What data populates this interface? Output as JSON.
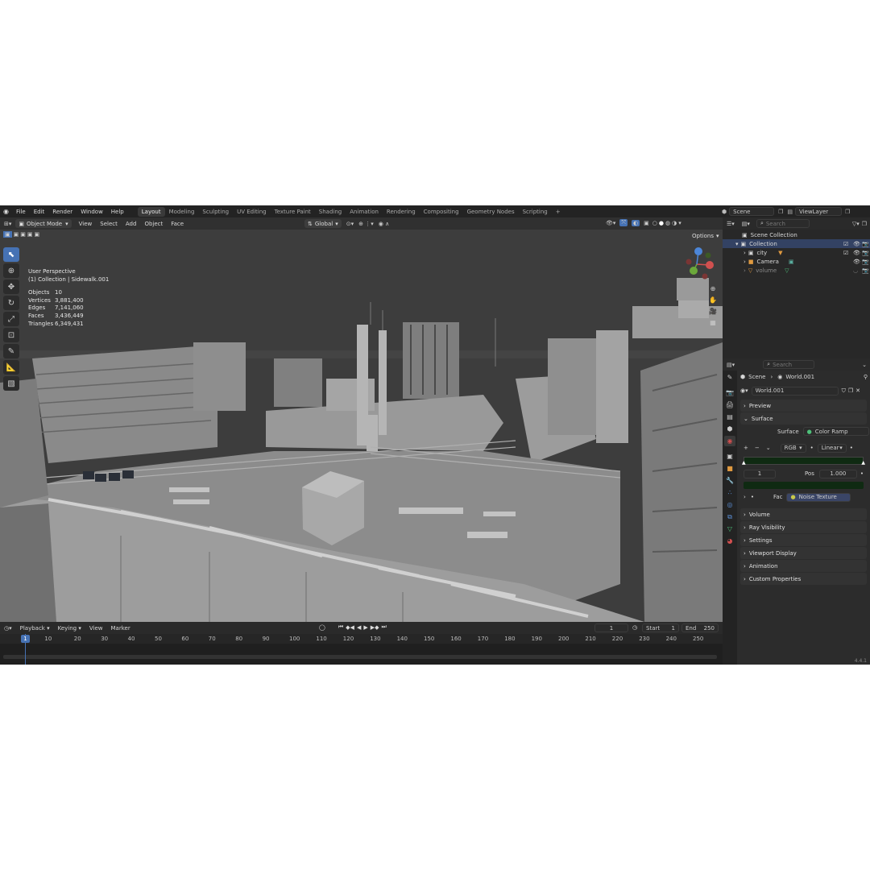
{
  "menubar": {
    "items": [
      "File",
      "Edit",
      "Render",
      "Window",
      "Help"
    ],
    "workspaces": [
      "Layout",
      "Modeling",
      "Sculpting",
      "UV Editing",
      "Texture Paint",
      "Shading",
      "Animation",
      "Rendering",
      "Compositing",
      "Geometry Nodes",
      "Scripting"
    ],
    "active_workspace": "Layout",
    "add_tab": "+",
    "scene": "Scene",
    "view_layer": "ViewLayer"
  },
  "viewport_header": {
    "mode": "Object Mode",
    "menus": [
      "View",
      "Select",
      "Add",
      "Object",
      "Face"
    ],
    "transform_orientation": "Global",
    "options": "Options"
  },
  "viewport": {
    "view_name": "User Perspective",
    "collection_line": "(1) Collection | Sidewalk.001",
    "stats": [
      {
        "k": "Objects",
        "v": "10"
      },
      {
        "k": "Vertices",
        "v": "3,881,400"
      },
      {
        "k": "Edges",
        "v": "7,141,060"
      },
      {
        "k": "Faces",
        "v": "3,436,449"
      },
      {
        "k": "Triangles",
        "v": "6,349,431"
      }
    ],
    "gizmo": {
      "x": "X",
      "y": "Y",
      "z": "Z"
    }
  },
  "timeline": {
    "menus": [
      "Playback",
      "Keying",
      "View",
      "Marker"
    ],
    "current_frame": "1",
    "start_label": "Start",
    "start": "1",
    "end_label": "End",
    "end": "250",
    "ticks": [
      "1",
      "10",
      "20",
      "30",
      "40",
      "50",
      "60",
      "70",
      "80",
      "90",
      "100",
      "110",
      "120",
      "130",
      "140",
      "150",
      "160",
      "170",
      "180",
      "190",
      "200",
      "210",
      "220",
      "230",
      "240",
      "250"
    ]
  },
  "outliner": {
    "search_placeholder": "Search",
    "root": "Scene Collection",
    "collection": "Collection",
    "items": [
      {
        "name": "city"
      },
      {
        "name": "Camera"
      },
      {
        "name": "volume"
      }
    ]
  },
  "properties": {
    "search_placeholder": "Search",
    "breadcrumb_scene": "Scene",
    "breadcrumb_world": "World.001",
    "world_name": "World.001",
    "surface_label": "Surface",
    "surface_value": "Color Ramp",
    "preview": "Preview",
    "surface": "Surface",
    "ramp_mode": "RGB",
    "ramp_interp": "Linear",
    "stop_index": "1",
    "pos_label": "Pos",
    "pos_value": "1.000",
    "fac_label": "Fac",
    "fac_value": "Noise Texture",
    "panels": [
      "Volume",
      "Ray Visibility",
      "Settings",
      "Viewport Display",
      "Animation",
      "Custom Properties"
    ],
    "colors": {
      "ramp": "#0f2a12",
      "accent": "#4672b4"
    }
  },
  "version": "4.4.1"
}
